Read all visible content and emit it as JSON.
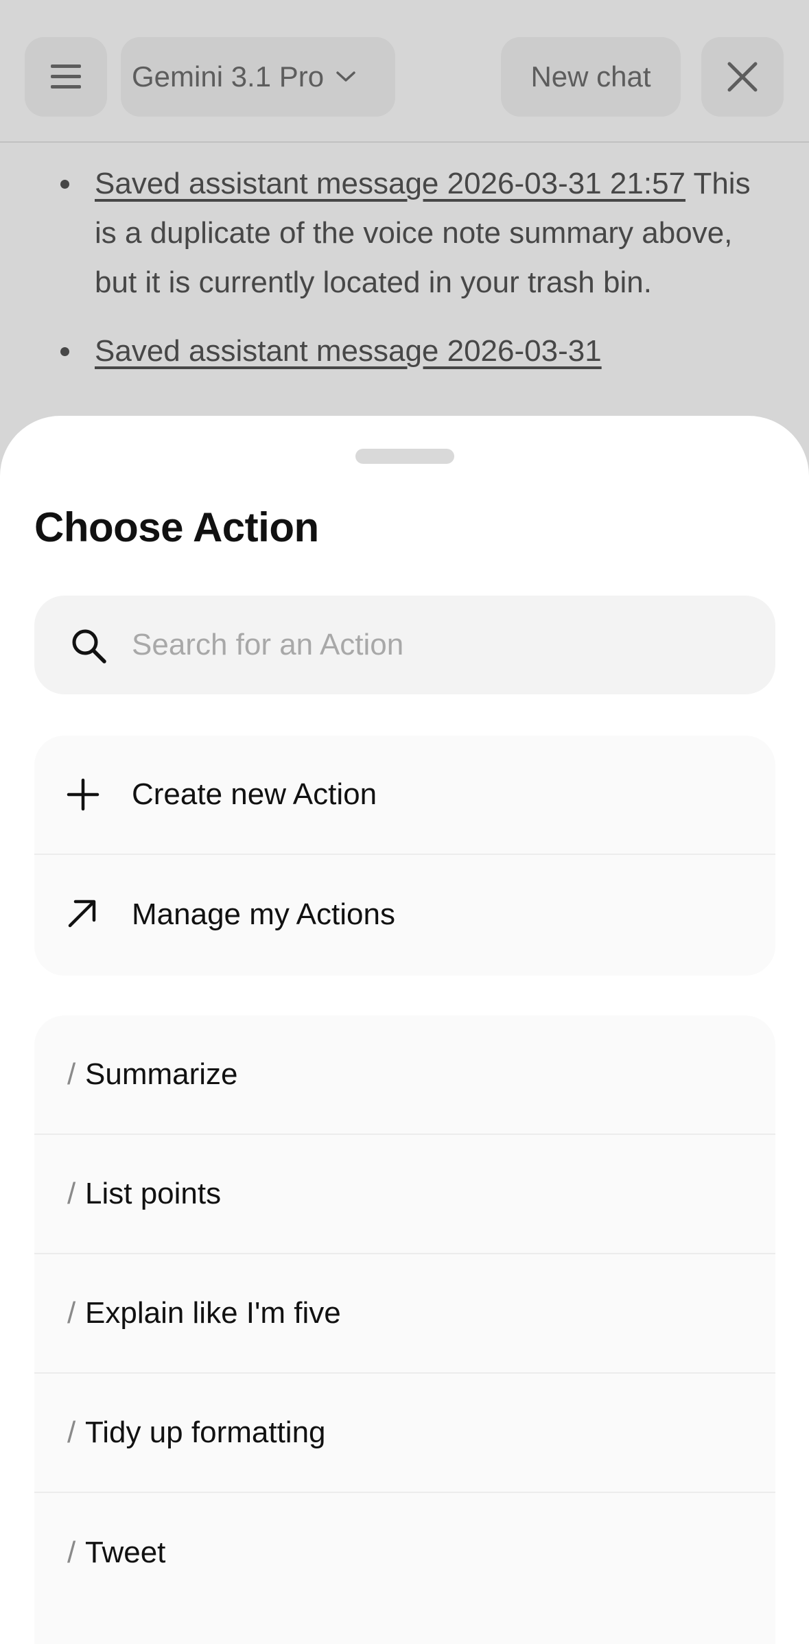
{
  "header": {
    "model_label": "Gemini 3.1 Pro",
    "new_chat_label": "New chat"
  },
  "chat": {
    "items": [
      {
        "link": "Saved assistant message 2026-03-31 21:57",
        "text": " This is a duplicate of the voice note summary above, but it is currently located in your trash bin."
      },
      {
        "link": "Saved assistant message 2026-03-31",
        "text": ""
      }
    ]
  },
  "sheet": {
    "title": "Choose Action",
    "search_placeholder": "Search for an Action",
    "create_label": "Create new Action",
    "manage_label": "Manage my Actions",
    "slash": "/",
    "actions": [
      "Summarize",
      "List points",
      "Explain like I'm five",
      "Tidy up formatting",
      "Tweet"
    ]
  },
  "icons": {
    "menu": "menu-icon",
    "model_dropdown": "chevron-down-icon",
    "close": "close-icon",
    "search": "search-icon",
    "create": "plus-icon",
    "manage": "arrow-up-right-icon"
  },
  "colors": {
    "sheet_background": "#ffffff",
    "card_background": "#fafafa",
    "search_background": "#f3f3f3",
    "text_primary": "#111111",
    "placeholder": "#a8a8a8"
  }
}
